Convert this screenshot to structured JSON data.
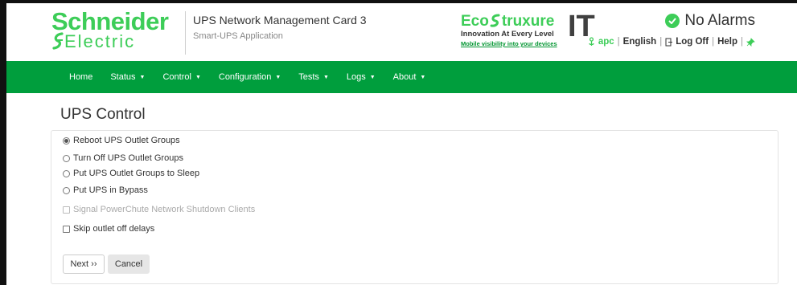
{
  "brand": {
    "logo_line1": "Schneider",
    "logo_line2": "Electric"
  },
  "product": {
    "title": "UPS Network Management Card 3",
    "subtitle": "Smart-UPS Application"
  },
  "ecostruxure": {
    "eco": "Eco",
    "truxure": "truxure",
    "tagline": "Innovation At Every Level",
    "link": "Mobile visibility into your devices",
    "it": "IT"
  },
  "alarm": {
    "text": "No Alarms",
    "color": "#3dcd58"
  },
  "userbar": {
    "user": "apc",
    "language": "English",
    "logoff": "Log Off",
    "help": "Help"
  },
  "nav": {
    "items": [
      {
        "label": "Home",
        "caret": ""
      },
      {
        "label": "Status",
        "caret": "▼"
      },
      {
        "label": "Control",
        "caret": "▼"
      },
      {
        "label": "Configuration",
        "caret": "▼"
      },
      {
        "label": "Tests",
        "caret": "▼"
      },
      {
        "label": "Logs",
        "caret": "▼"
      },
      {
        "label": "About",
        "caret": "▼"
      }
    ]
  },
  "page": {
    "title": "UPS Control"
  },
  "options": {
    "reboot": "Reboot UPS Outlet Groups",
    "turn_off": "Turn Off UPS Outlet Groups",
    "sleep": "Put UPS Outlet Groups to Sleep",
    "bypass": "Put UPS in Bypass",
    "signal": "Signal PowerChute Network Shutdown Clients",
    "skip_delays": "Skip outlet off delays",
    "selected": "Reboot UPS Outlet Groups"
  },
  "buttons": {
    "next": "Next ››",
    "cancel": "Cancel"
  },
  "colors": {
    "brand_green": "#3dcd58",
    "nav_green": "#009e3d"
  }
}
